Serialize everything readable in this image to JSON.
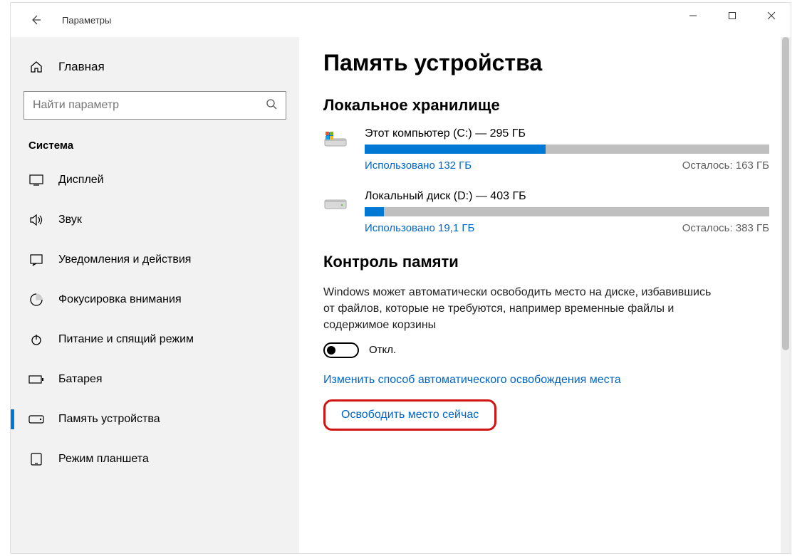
{
  "window": {
    "title": "Параметры"
  },
  "sidebar": {
    "home": "Главная",
    "search_placeholder": "Найти параметр",
    "section": "Система",
    "items": [
      {
        "id": "display",
        "label": "Дисплей"
      },
      {
        "id": "sound",
        "label": "Звук"
      },
      {
        "id": "notifications",
        "label": "Уведомления и действия"
      },
      {
        "id": "focus",
        "label": "Фокусировка внимания"
      },
      {
        "id": "power",
        "label": "Питание и спящий режим"
      },
      {
        "id": "battery",
        "label": "Батарея"
      },
      {
        "id": "storage",
        "label": "Память устройства"
      },
      {
        "id": "tablet",
        "label": "Режим планшета"
      }
    ]
  },
  "main": {
    "title": "Память устройства",
    "local_storage": "Локальное хранилище",
    "drives": [
      {
        "name": "Этот компьютер (C:) — 295 ГБ",
        "used": "Использовано 132 ГБ",
        "free": "Осталось: 163 ГБ",
        "pct": 44.7
      },
      {
        "name": "Локальный диск (D:) — 403 ГБ",
        "used": "Использовано 19,1 ГБ",
        "free": "Осталось: 383 ГБ",
        "pct": 4.7
      }
    ],
    "sense_title": "Контроль памяти",
    "sense_desc": "Windows может автоматически освободить место на диске, избавившись от файлов, которые не требуются, например временные файлы и содержимое корзины",
    "toggle_label": "Откл.",
    "link_change": "Изменить способ автоматического освобождения места",
    "link_freeup": "Освободить место сейчас"
  }
}
